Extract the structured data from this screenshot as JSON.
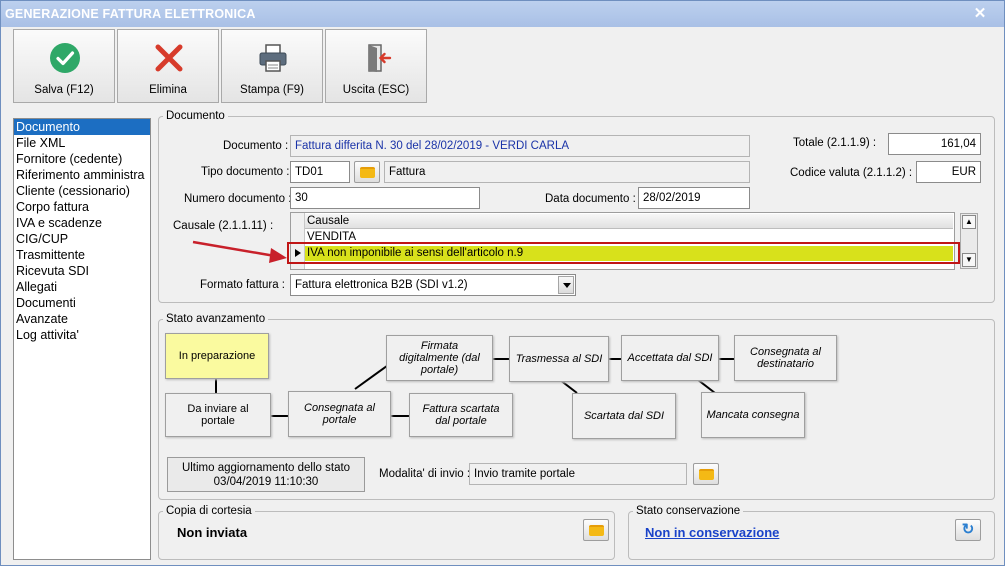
{
  "window": {
    "title": "GENERAZIONE FATTURA ELETTRONICA"
  },
  "toolbar": {
    "save_label": "Salva (F12)",
    "delete_label": "Elimina",
    "print_label": "Stampa (F9)",
    "exit_label": "Uscita (ESC)"
  },
  "nav": {
    "items": [
      "Documento",
      "File XML",
      "Fornitore (cedente)",
      "Riferimento amministra",
      "Cliente (cessionario)",
      "Corpo fattura",
      "IVA e scadenze",
      "CIG/CUP",
      "Trasmittente",
      "Ricevuta SDI",
      "Allegati",
      "Documenti",
      "Avanzate",
      "Log attivita'"
    ]
  },
  "documento": {
    "group_label": "Documento",
    "documento_label": "Documento :",
    "documento_value": "Fattura differita N. 30 del 28/02/2019 - VERDI CARLA",
    "tipo_label": "Tipo documento :",
    "tipo_code": "TD01",
    "tipo_desc": "Fattura",
    "numero_label": "Numero documento :",
    "numero_value": "30",
    "data_label": "Data documento :",
    "data_value": "28/02/2019",
    "totale_label": "Totale (2.1.1.9) :",
    "totale_value": "161,04",
    "valuta_label": "Codice valuta (2.1.1.2) :",
    "valuta_value": "EUR",
    "causale_label": "Causale (2.1.1.11) :",
    "causale_header": "Causale",
    "causale_rows": [
      "VENDITA",
      "IVA non imponibile ai sensi dell'articolo n.9"
    ],
    "formato_label": "Formato fattura :",
    "formato_value": "Fattura elettronica B2B (SDI v1.2)"
  },
  "stato": {
    "group_label": "Stato avanzamento",
    "steps": {
      "in_preparazione": "In preparazione",
      "da_inviare": "Da inviare al portale",
      "consegnata_portale": "Consegnata al portale",
      "firmata": "Firmata digitalmente (dal portale)",
      "scartata_portale": "Fattura scartata dal portale",
      "trasmessa": "Trasmessa al SDI",
      "scartata_sdi": "Scartata dal SDI",
      "accettata": "Accettata dal SDI",
      "consegnata_dest": "Consegnata al destinatario",
      "mancata": "Mancata consegna"
    },
    "ultimo_line1": "Ultimo aggiornamento dello stato",
    "ultimo_line2": "03/04/2019 11:10:30",
    "modalita_label": "Modalita' di invio :",
    "modalita_value": "Invio tramite portale"
  },
  "copia": {
    "group_label": "Copia di cortesia",
    "value": "Non inviata"
  },
  "conservazione": {
    "group_label": "Stato conservazione",
    "value": "Non in conservazione"
  },
  "colors": {
    "title_bar": "#a9c0e6",
    "selection": "#1c6ec2",
    "active_step": "#fafa9f",
    "highlight_row": "#d8e11b",
    "arrow": "#c01515",
    "link": "#1a43c9"
  }
}
